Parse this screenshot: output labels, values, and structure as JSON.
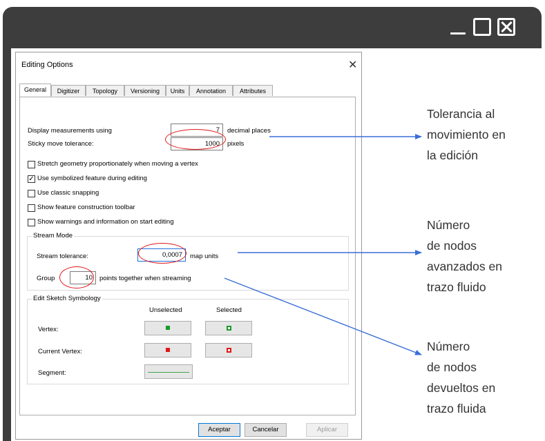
{
  "dialog": {
    "title": "Editing Options",
    "close_glyph": "✕",
    "tabs": [
      "General",
      "Digitizer",
      "Topology",
      "Versioning",
      "Units",
      "Annotation",
      "Attributes"
    ],
    "display_label": "Display measurements using",
    "display_value": "7",
    "display_unit": "decimal places",
    "sticky_label": "Sticky move tolerance:",
    "sticky_value": "1000",
    "sticky_unit": "pixels",
    "checkboxes": [
      {
        "label": "Stretch geometry proportionately when moving a vertex",
        "checked": false
      },
      {
        "label": "Use symbolized feature during editing",
        "checked": true
      },
      {
        "label": "Use classic snapping",
        "checked": false
      },
      {
        "label": "Show feature construction toolbar",
        "checked": false
      },
      {
        "label": "Show warnings and information on start editing",
        "checked": false
      }
    ],
    "stream": {
      "group_title": "Stream Mode",
      "tolerance_label": "Stream tolerance:",
      "tolerance_value": "0,0007",
      "tolerance_unit": "map units",
      "group_label": "Group",
      "group_value": "10",
      "group_suffix": "points together when streaming"
    },
    "sketch": {
      "group_title": "Edit Sketch Symbology",
      "col_unselected": "Unselected",
      "col_selected": "Selected",
      "vertex_label": "Vertex:",
      "current_vertex_label": "Current Vertex:",
      "segment_label": "Segment:",
      "colors": {
        "vertex": "#1a9a2a",
        "current": "#e01818",
        "segment": "#3fa34d"
      }
    },
    "buttons": {
      "ok": "Aceptar",
      "cancel": "Cancelar",
      "apply": "Aplicar"
    }
  },
  "annotations": {
    "sticky": [
      "Tolerancia al",
      "movimiento en",
      "la edición"
    ],
    "stream_tolerance": [
      "Número",
      "de nodos",
      "avanzados en",
      "trazo fluido"
    ],
    "group": [
      "Número",
      "de nodos",
      "devueltos en",
      "trazo fluida"
    ]
  },
  "colors": {
    "frame": "#3d3d3d",
    "arrow": "#3a6fd8",
    "highlight": "#e0191c"
  }
}
